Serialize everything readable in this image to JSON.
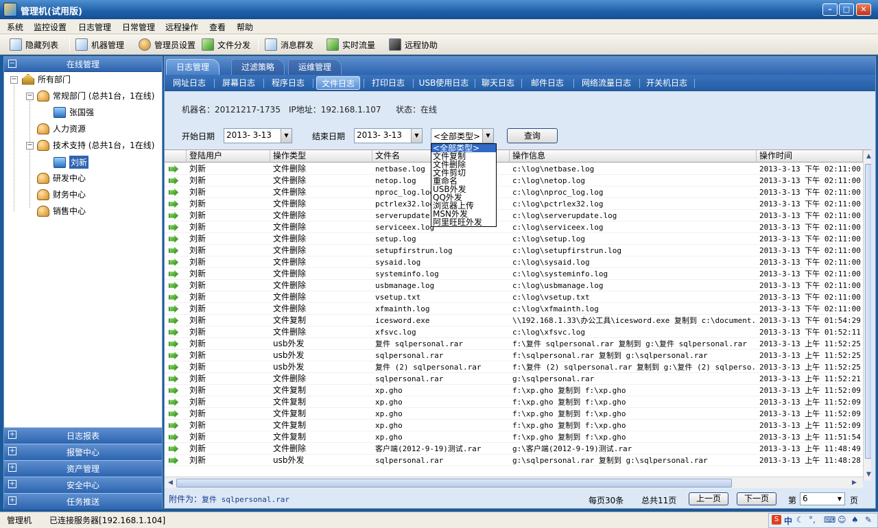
{
  "window": {
    "title": "管理机(试用版)"
  },
  "menu": [
    "系统",
    "监控设置",
    "日志管理",
    "日常管理",
    "远程操作",
    "查看",
    "帮助"
  ],
  "toolbar": [
    "隐藏列表",
    "机器管理",
    "管理员设置",
    "文件分发",
    "消息群发",
    "实时流量",
    "远程协助"
  ],
  "sidebar": {
    "header": "在线管理",
    "tree": [
      {
        "label": "所有部门",
        "icon": "home-icon"
      },
      {
        "label": "常规部门 (总共1台，1在线)",
        "icon": "group-icon"
      },
      {
        "label": "张国强",
        "icon": "computer-icon"
      },
      {
        "label": "人力资源",
        "icon": "group-icon"
      },
      {
        "label": "技术支持 (总共1台，1在线)",
        "icon": "group-icon"
      },
      {
        "label": "刘新",
        "icon": "computer-icon"
      },
      {
        "label": "研发中心",
        "icon": "group-icon"
      },
      {
        "label": "财务中心",
        "icon": "group-icon"
      },
      {
        "label": "销售中心",
        "icon": "group-icon"
      }
    ],
    "bottom": [
      "日志报表",
      "报警中心",
      "资产管理",
      "安全中心",
      "任务推送"
    ]
  },
  "tabs": [
    "日志管理",
    "过滤策略",
    "运维管理"
  ],
  "subtabs": [
    "网址日志",
    "屏幕日志",
    "程序日志",
    "文件日志",
    "打印日志",
    "USB使用日志",
    "聊天日志",
    "邮件日志",
    "网络流量日志",
    "开关机日志"
  ],
  "info": {
    "machine": "机器名：20121217-1735",
    "ip": "IP地址：192.168.1.107",
    "status": "状态：在线"
  },
  "filter": {
    "start_label": "开始日期",
    "start_value": "2013- 3-13",
    "end_label": "结束日期",
    "end_value": "2013- 3-13",
    "type_value": "<全部类型>",
    "query_label": "查询"
  },
  "type_options": [
    "<全部类型>",
    "文件复制",
    "文件删除",
    "文件剪切",
    "重命名",
    "USB外发",
    "QQ外发",
    "浏览器上传",
    "MSN外发",
    "阿里旺旺外发"
  ],
  "columns": [
    "登陆用户",
    "操作类型",
    "文件名",
    "操作信息",
    "操作时间"
  ],
  "rows": [
    [
      "刘新",
      "文件删除",
      "netbase.log",
      "c:\\log\\netbase.log",
      "2013-3-13 下午 02:11:00"
    ],
    [
      "刘新",
      "文件删除",
      "netop.log",
      "c:\\log\\netop.log",
      "2013-3-13 下午 02:11:00"
    ],
    [
      "刘新",
      "文件删除",
      "nproc_log.log",
      "c:\\log\\nproc_log.log",
      "2013-3-13 下午 02:11:00"
    ],
    [
      "刘新",
      "文件删除",
      "pctrlex32.log",
      "c:\\log\\pctrlex32.log",
      "2013-3-13 下午 02:11:00"
    ],
    [
      "刘新",
      "文件删除",
      "serverupdate.l",
      "c:\\log\\serverupdate.log",
      "2013-3-13 下午 02:11:00"
    ],
    [
      "刘新",
      "文件删除",
      "serviceex.log",
      "c:\\log\\serviceex.log",
      "2013-3-13 下午 02:11:00"
    ],
    [
      "刘新",
      "文件删除",
      "setup.log",
      "c:\\log\\setup.log",
      "2013-3-13 下午 02:11:00"
    ],
    [
      "刘新",
      "文件删除",
      "setupfirstrun.log",
      "c:\\log\\setupfirstrun.log",
      "2013-3-13 下午 02:11:00"
    ],
    [
      "刘新",
      "文件删除",
      "sysaid.log",
      "c:\\log\\sysaid.log",
      "2013-3-13 下午 02:11:00"
    ],
    [
      "刘新",
      "文件删除",
      "systeminfo.log",
      "c:\\log\\systeminfo.log",
      "2013-3-13 下午 02:11:00"
    ],
    [
      "刘新",
      "文件删除",
      "usbmanage.log",
      "c:\\log\\usbmanage.log",
      "2013-3-13 下午 02:11:00"
    ],
    [
      "刘新",
      "文件删除",
      "vsetup.txt",
      "c:\\log\\vsetup.txt",
      "2013-3-13 下午 02:11:00"
    ],
    [
      "刘新",
      "文件删除",
      "xfmainth.log",
      "c:\\log\\xfmainth.log",
      "2013-3-13 下午 02:11:00"
    ],
    [
      "刘新",
      "文件复制",
      "icesword.exe",
      "\\\\192.168.1.33\\办公工具\\icesword.exe 复制到 c:\\document...",
      "2013-3-13 下午 01:54:29"
    ],
    [
      "刘新",
      "文件删除",
      "xfsvc.log",
      "c:\\log\\xfsvc.log",
      "2013-3-13 下午 01:52:11"
    ],
    [
      "刘新",
      "usb外发",
      "复件 sqlpersonal.rar",
      "f:\\复件 sqlpersonal.rar 复制到 g:\\复件 sqlpersonal.rar",
      "2013-3-13 上午 11:52:25"
    ],
    [
      "刘新",
      "usb外发",
      "sqlpersonal.rar",
      "f:\\sqlpersonal.rar 复制到 g:\\sqlpersonal.rar",
      "2013-3-13 上午 11:52:25"
    ],
    [
      "刘新",
      "usb外发",
      "复件 (2) sqlpersonal.rar",
      "f:\\复件 (2) sqlpersonal.rar 复制到 g:\\复件 (2) sqlperso...",
      "2013-3-13 上午 11:52:25"
    ],
    [
      "刘新",
      "文件删除",
      "sqlpersonal.rar",
      "g:\\sqlpersonal.rar",
      "2013-3-13 上午 11:52:21"
    ],
    [
      "刘新",
      "文件复制",
      "xp.gho",
      "f:\\xp.gho 复制到 f:\\xp.gho",
      "2013-3-13 上午 11:52:09"
    ],
    [
      "刘新",
      "文件复制",
      "xp.gho",
      "f:\\xp.gho 复制到 f:\\xp.gho",
      "2013-3-13 上午 11:52:09"
    ],
    [
      "刘新",
      "文件复制",
      "xp.gho",
      "f:\\xp.gho 复制到 f:\\xp.gho",
      "2013-3-13 上午 11:52:09"
    ],
    [
      "刘新",
      "文件复制",
      "xp.gho",
      "f:\\xp.gho 复制到 f:\\xp.gho",
      "2013-3-13 上午 11:52:09"
    ],
    [
      "刘新",
      "文件复制",
      "xp.gho",
      "f:\\xp.gho 复制到 f:\\xp.gho",
      "2013-3-13 上午 11:51:54"
    ],
    [
      "刘新",
      "文件删除",
      "客户端(2012-9-19)测试.rar",
      "g:\\客户端(2012-9-19)测试.rar",
      "2013-3-13 上午 11:48:49"
    ],
    [
      "刘新",
      "usb外发",
      "sqlpersonal.rar",
      "g:\\sqlpersonal.rar 复制到 g:\\sqlpersonal.rar",
      "2013-3-13 上午 11:48:28"
    ]
  ],
  "footer": {
    "attach_label": "附件为：",
    "attach_value": "复件 sqlpersonal.rar",
    "per_page": "每页30条",
    "total": "总共11页",
    "prev": "上一页",
    "next": "下一页",
    "page_label": "第",
    "page_value": "6",
    "page_suffix": "页"
  },
  "status": {
    "app": "管理机",
    "conn": "已连接服务器[192.168.1.104]",
    "ime_text": "中"
  }
}
